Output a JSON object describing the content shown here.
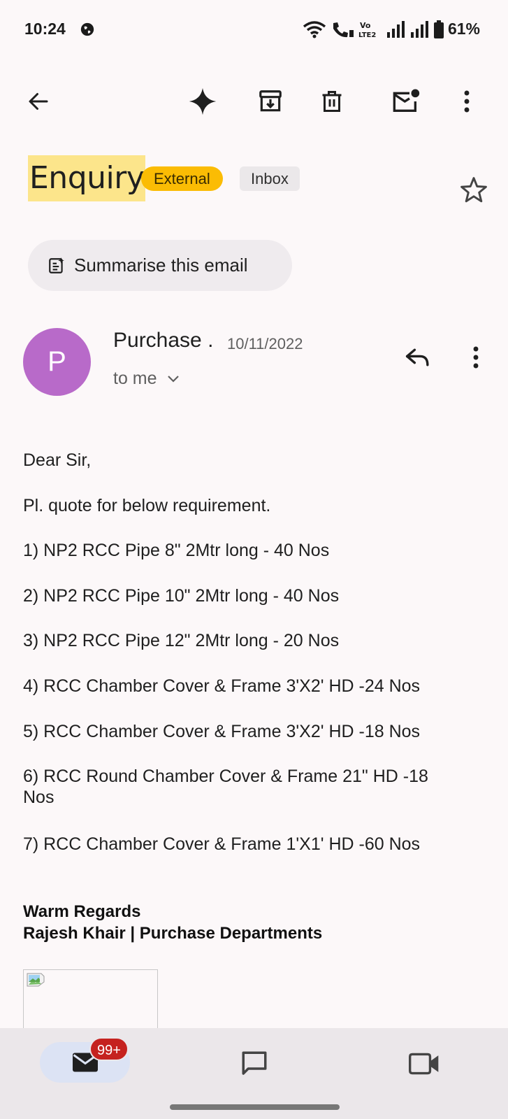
{
  "status": {
    "time": "10:24",
    "battery": "61%"
  },
  "toolbar": {
    "back_icon": "arrow-back-icon",
    "actions": [
      "sparkle-icon",
      "archive-icon",
      "delete-icon",
      "mark-unread-icon",
      "more-vert-icon"
    ]
  },
  "email": {
    "subject": "Enquiry",
    "label_external": "External",
    "label_inbox": "Inbox",
    "summarise": "Summarise this email",
    "sender_initial": "P",
    "sender": "Purchase .",
    "date": "10/11/2022",
    "to": "to me",
    "greeting": "Dear Sir,",
    "intro": "Pl. quote for below requirement.",
    "items": [
      "1) NP2 RCC Pipe 8\" 2Mtr long - 40 Nos",
      "2) NP2 RCC Pipe 10\" 2Mtr long - 40 Nos",
      "3) NP2 RCC Pipe 12\" 2Mtr long - 20 Nos",
      "4) RCC Chamber Cover & Frame 3'X2' HD -24 Nos",
      "5)  RCC Chamber Cover & Frame 3'X2' HD -18 Nos",
      "6) RCC Round Chamber Cover & Frame 21\" HD -18 Nos",
      "7) RCC Chamber Cover & Frame 1'X1' HD -60 Nos"
    ],
    "signoff": "Warm Regards",
    "signature": "Rajesh Khair | Purchase Departments"
  },
  "bottom_nav": {
    "mail_badge": "99+"
  },
  "colors": {
    "accent_highlight": "#fce58b",
    "external_chip": "#fbbc04",
    "avatar": "#b86ac9",
    "badge": "#c5221f"
  }
}
